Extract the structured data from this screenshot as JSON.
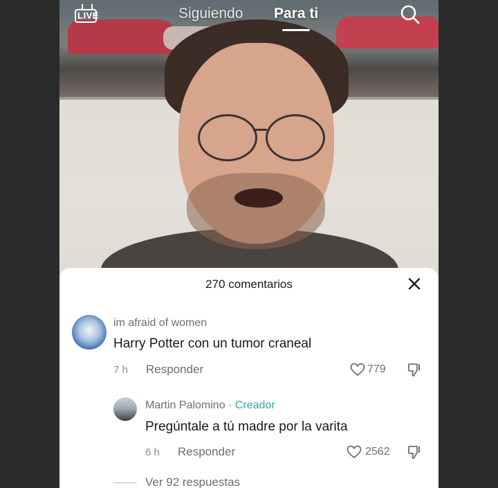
{
  "topbar": {
    "live_label": "LIVE",
    "tabs": [
      {
        "label": "Siguiendo",
        "active": false
      },
      {
        "label": "Para ti",
        "active": true
      }
    ],
    "search_icon": "search-icon"
  },
  "comments_panel": {
    "title": "270 comentarios",
    "close_icon": "close-icon",
    "comments": [
      {
        "username": "im afraid of women",
        "text": "Harry Potter con un tumor craneal",
        "time": "7 h",
        "reply_label": "Responder",
        "likes": "779"
      }
    ],
    "replies": [
      {
        "username": "Martin Palomino",
        "separator": " · ",
        "badge": "Creador",
        "text": "Pregúntale a tú madre por la varita",
        "time": "6 h",
        "reply_label": "Responder",
        "likes": "2562"
      }
    ],
    "view_more": "Ver 92 respuestas"
  },
  "colors": {
    "background": "#2b2b2b",
    "sheet": "#ffffff",
    "text_primary": "#161823",
    "text_secondary": "#6e6e73",
    "creator_badge": "#3a9fb3"
  }
}
